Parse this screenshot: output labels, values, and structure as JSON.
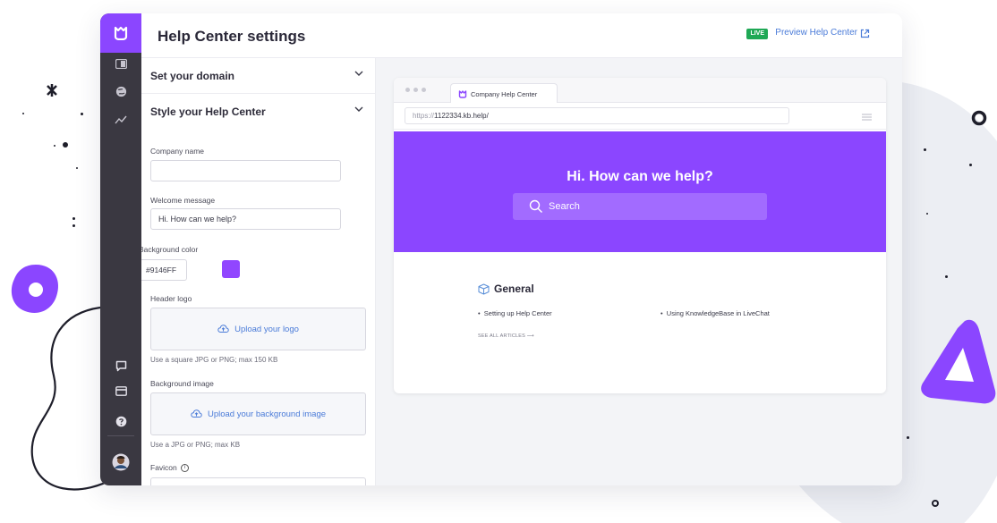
{
  "header": {
    "title": "Help Center settings",
    "live_badge": "LIVE",
    "preview_link": "Preview Help Center"
  },
  "sidebar_icons": [
    "logo-icon",
    "dashboard-icon",
    "globe-icon",
    "analytics-icon",
    "chat-icon",
    "billing-icon",
    "help-icon",
    "user-avatar"
  ],
  "settings": {
    "sections": [
      {
        "label": "Set your domain",
        "expanded": false
      },
      {
        "label": "Style your Help Center",
        "expanded": true
      }
    ],
    "company_name": {
      "label": "Company name",
      "value": ""
    },
    "welcome_message": {
      "label": "Welcome message",
      "value": "Hi. How can we help?"
    },
    "background_color": {
      "label": "Background color",
      "value": "#9146FF",
      "swatch": "#9146ff"
    },
    "header_logo": {
      "label": "Header logo",
      "upload": "Upload your logo",
      "hint": "Use a square JPG or PNG; max 150 KB"
    },
    "background_image": {
      "label": "Background image",
      "upload": "Upload your background image",
      "hint": "Use a JPG or PNG; max KB"
    },
    "favicon": {
      "label": "Favicon"
    }
  },
  "preview": {
    "tab_title": "Company Help Center",
    "url_prefix": "https://",
    "url_rest": "1122334.kb.help/",
    "hero_title": "Hi. How can we help?",
    "search_placeholder": "Search",
    "hero_color": "#8b46ff",
    "category": "General",
    "articles": [
      "Setting up Help Center",
      "Using KnowledgeBase in LiveChat"
    ],
    "see_all": "SEE ALL ARTICLES"
  },
  "colors": {
    "accent": "#8b46ff",
    "live": "#1fa855",
    "link": "#4a7bd8"
  }
}
